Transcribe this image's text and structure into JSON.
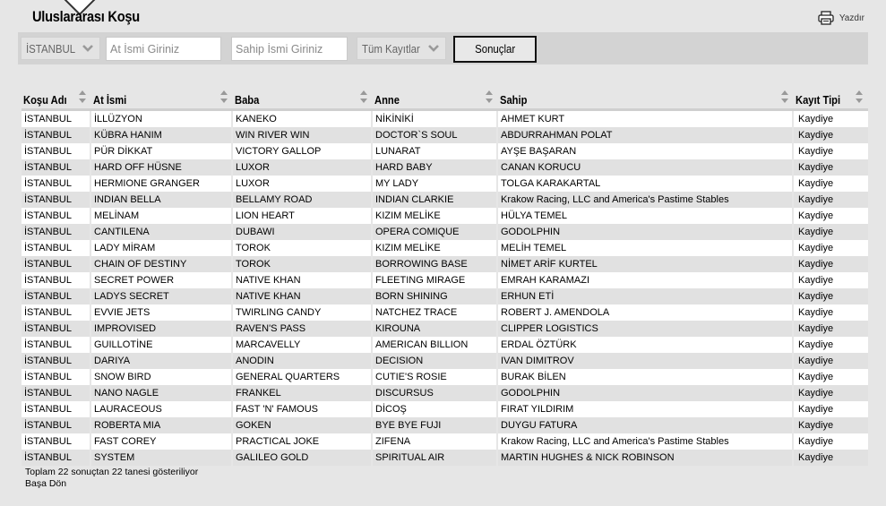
{
  "header": {
    "title": "Uluslararası Koşu",
    "print_label": "Yazdır"
  },
  "filters": {
    "city_select": "İSTANBUL",
    "horse_name_placeholder": "At İsmi Giriniz",
    "owner_name_placeholder": "Sahip İsmi Giriniz",
    "records_select": "Tüm Kayıtlar",
    "submit_label": "Sonuçlar"
  },
  "table": {
    "headers": [
      "Koşu Adı",
      "At İsmi",
      "Baba",
      "Anne",
      "Sahip",
      "Kayıt Tipi"
    ],
    "rows": [
      [
        "İSTANBUL",
        "İLLÜZYON",
        "KANEKO",
        "NİKİNİKİ",
        "AHMET KURT",
        "Kaydiye"
      ],
      [
        "İSTANBUL",
        "KÜBRA HANIM",
        "WIN RIVER WIN",
        "DOCTOR`S SOUL",
        "ABDURRAHMAN POLAT",
        "Kaydiye"
      ],
      [
        "İSTANBUL",
        "PÜR DİKKAT",
        "VICTORY GALLOP",
        "LUNARAT",
        "AYŞE BAŞARAN",
        "Kaydiye"
      ],
      [
        "İSTANBUL",
        "HARD OFF HÜSNE",
        "LUXOR",
        "HARD BABY",
        "CANAN KORUCU",
        "Kaydiye"
      ],
      [
        "İSTANBUL",
        "HERMIONE GRANGER",
        "LUXOR",
        "MY LADY",
        "TOLGA KARAKARTAL",
        "Kaydiye"
      ],
      [
        "İSTANBUL",
        "INDIAN BELLA",
        "BELLAMY ROAD",
        "INDIAN CLARKIE",
        "Krakow Racing, LLC and America's Pastime Stables",
        "Kaydiye"
      ],
      [
        "İSTANBUL",
        "MELİNAM",
        "LION HEART",
        "KIZIM MELİKE",
        "HÜLYA TEMEL",
        "Kaydiye"
      ],
      [
        "İSTANBUL",
        "CANTILENA",
        "DUBAWI",
        "OPERA COMIQUE",
        "GODOLPHIN",
        "Kaydiye"
      ],
      [
        "İSTANBUL",
        "LADY MİRAM",
        "TOROK",
        "KIZIM MELİKE",
        "MELİH TEMEL",
        "Kaydiye"
      ],
      [
        "İSTANBUL",
        "CHAIN OF DESTINY",
        "TOROK",
        "BORROWING BASE",
        "NİMET ARİF KURTEL",
        "Kaydiye"
      ],
      [
        "İSTANBUL",
        "SECRET POWER",
        "NATIVE KHAN",
        "FLEETING MIRAGE",
        "EMRAH KARAMAZI",
        "Kaydiye"
      ],
      [
        "İSTANBUL",
        "LADYS SECRET",
        "NATIVE KHAN",
        "BORN SHINING",
        "ERHUN ETİ",
        "Kaydiye"
      ],
      [
        "İSTANBUL",
        "EVVIE JETS",
        "TWIRLING CANDY",
        "NATCHEZ TRACE",
        "ROBERT J. AMENDOLA",
        "Kaydiye"
      ],
      [
        "İSTANBUL",
        "IMPROVISED",
        "RAVEN'S PASS",
        "KIROUNA",
        "CLIPPER LOGISTICS",
        "Kaydiye"
      ],
      [
        "İSTANBUL",
        "GUILLOTİNE",
        "MARCAVELLY",
        "AMERICAN BILLION",
        "ERDAL ÖZTÜRK",
        "Kaydiye"
      ],
      [
        "İSTANBUL",
        "DARIYA",
        "ANODIN",
        "DECISION",
        "IVAN DIMITROV",
        "Kaydiye"
      ],
      [
        "İSTANBUL",
        "SNOW BIRD",
        "GENERAL QUARTERS",
        "CUTIE'S ROSIE",
        "BURAK BİLEN",
        "Kaydiye"
      ],
      [
        "İSTANBUL",
        "NANO NAGLE",
        "FRANKEL",
        "DISCURSUS",
        "GODOLPHIN",
        "Kaydiye"
      ],
      [
        "İSTANBUL",
        "LAURACEOUS",
        "FAST 'N' FAMOUS",
        "DİCOŞ",
        "FIRAT YILDIRIM",
        "Kaydiye"
      ],
      [
        "İSTANBUL",
        "ROBERTA MIA",
        "GOKEN",
        "BYE BYE FUJI",
        "DUYGU FATURA",
        "Kaydiye"
      ],
      [
        "İSTANBUL",
        "FAST COREY",
        "PRACTICAL JOKE",
        "ZIFENA",
        "Krakow Racing, LLC and America's Pastime Stables",
        "Kaydiye"
      ],
      [
        "İSTANBUL",
        "SYSTEM",
        "GALILEO GOLD",
        "SPIRITUAL AIR",
        "MARTIN HUGHES & NICK ROBINSON",
        "Kaydiye"
      ]
    ]
  },
  "footer": {
    "summary": "Toplam 22 sonuçtan 22 tanesi gösteriliyor",
    "back_link": "Başa Dön"
  },
  "colors": {
    "page_bg": "#e6e6e6",
    "filter_bar_bg": "#d3d3d3",
    "row_odd": "#ffffff",
    "row_even": "#e1e1e1"
  }
}
